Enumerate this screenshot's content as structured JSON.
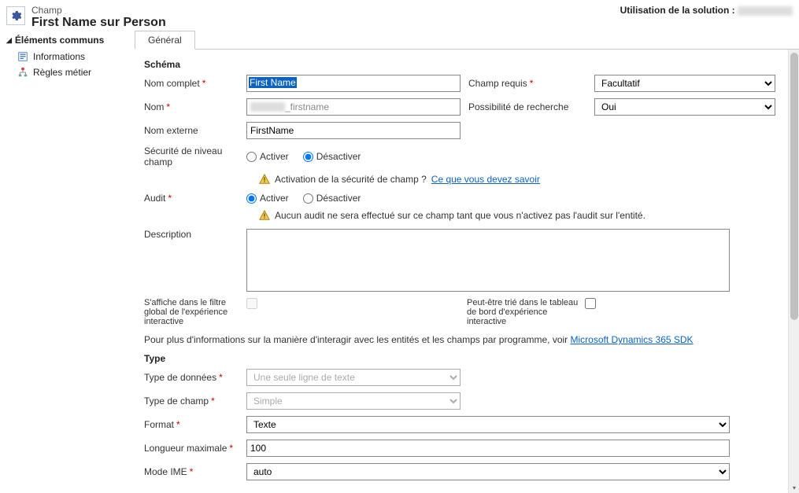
{
  "header": {
    "crumb": "Champ",
    "title": "First Name sur Person",
    "usage_label": "Utilisation de la solution :"
  },
  "sidebar": {
    "heading": "Éléments communs",
    "items": [
      {
        "label": "Informations"
      },
      {
        "label": "Règles métier"
      }
    ]
  },
  "tab": "Général",
  "sections": {
    "schema": "Schéma",
    "type": "Type"
  },
  "schema": {
    "display_name_label": "Nom complet",
    "display_name_value": "First Name",
    "field_requirement_label": "Champ requis",
    "field_requirement_value": "Facultatif",
    "name_label": "Nom",
    "name_suffix": "_firstname",
    "searchable_label": "Possibilité de recherche",
    "searchable_value": "Oui",
    "external_name_label": "Nom externe",
    "external_name_value": "FirstName",
    "fls_label": "Sécurité de niveau champ",
    "enable": "Activer",
    "disable": "Désactiver",
    "fls_warn_text": "Activation de la sécurité de champ ?",
    "fls_warn_link": "Ce que vous devez savoir",
    "audit_label": "Audit",
    "audit_warn": "Aucun audit ne sera effectué sur ce champ tant que vous n'activez pas l'audit sur l'entité.",
    "description_label": "Description",
    "global_filter_label": "S'affiche dans le filtre global de l'expérience interactive",
    "sortable_label": "Peut-être trié dans le tableau de bord d'expérience interactive",
    "note_pre": "Pour plus d'informations sur la manière d'interagir avec les entités et les champs par programme, voir ",
    "note_link": "Microsoft Dynamics 365 SDK"
  },
  "type": {
    "datatype_label": "Type de données",
    "datatype_value": "Une seule ligne de texte",
    "fieldtype_label": "Type de champ",
    "fieldtype_value": "Simple",
    "format_label": "Format",
    "format_value": "Texte",
    "maxlen_label": "Longueur maximale",
    "maxlen_value": "100",
    "ime_label": "Mode IME",
    "ime_value": "auto"
  }
}
